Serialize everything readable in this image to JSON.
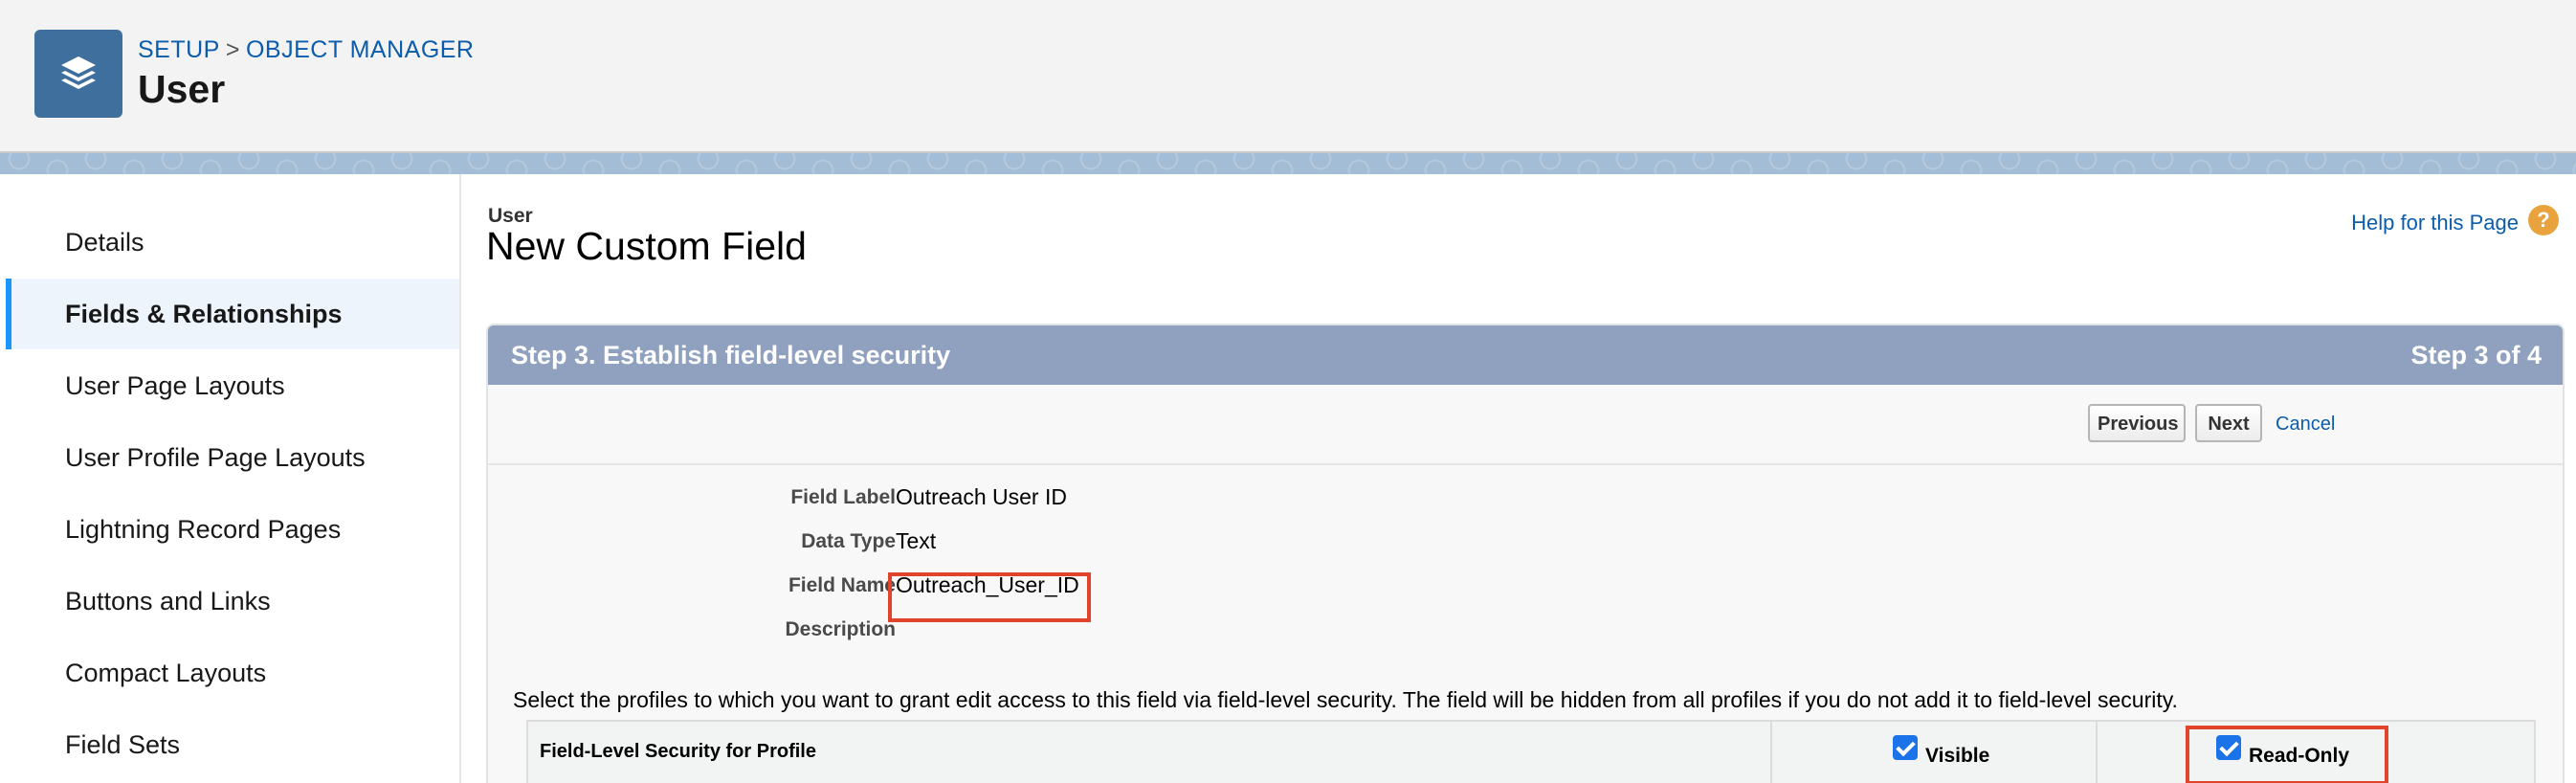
{
  "header": {
    "breadcrumb": {
      "setup": "SETUP",
      "separator": ">",
      "object_manager": "OBJECT MANAGER"
    },
    "title": "User",
    "icon": "layers-icon",
    "icon_color": "#3e6f9d"
  },
  "sidebar": {
    "active_color": "#1b96ff",
    "items": [
      {
        "label": "Details",
        "active": false
      },
      {
        "label": "Fields & Relationships",
        "active": true
      },
      {
        "label": "User Page Layouts",
        "active": false
      },
      {
        "label": "User Profile Page Layouts",
        "active": false
      },
      {
        "label": "Lightning Record Pages",
        "active": false
      },
      {
        "label": "Buttons and Links",
        "active": false
      },
      {
        "label": "Compact Layouts",
        "active": false
      },
      {
        "label": "Field Sets",
        "active": false
      }
    ]
  },
  "main": {
    "object_type": "User",
    "heading": "New Custom Field",
    "help_link": "Help for this Page",
    "help_icon": "?",
    "step": {
      "title": "Step 3. Establish field-level security",
      "count": "Step 3 of 4",
      "header_color": "#8fa1be"
    },
    "buttons": {
      "previous": "Previous",
      "next": "Next",
      "cancel": "Cancel"
    },
    "fields": [
      {
        "label": "Field Label",
        "value": "Outreach User ID"
      },
      {
        "label": "Data Type",
        "value": "Text"
      },
      {
        "label": "Field Name",
        "value": "Outreach_User_ID",
        "highlighted": true
      },
      {
        "label": "Description",
        "value": ""
      }
    ],
    "instructions": "Select the profiles to which you want to grant edit access to this field via field-level security. The field will be hidden from all profiles if you do not add it to field-level security.",
    "fls_table": {
      "profile_header": "Field-Level Security for Profile",
      "visible_label": "Visible",
      "visible_checked": true,
      "readonly_label": "Read-Only",
      "readonly_checked": true,
      "highlight_color": "#e0442a"
    }
  }
}
